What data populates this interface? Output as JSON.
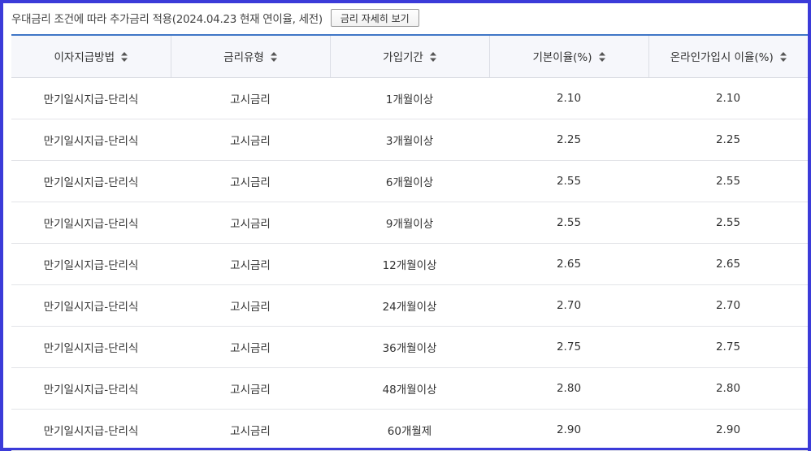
{
  "notice": {
    "text": "우대금리 조건에 따라 추가금리 적용(2024.04.23 현재 연이율, 세전)",
    "detail_button": "금리 자세히 보기"
  },
  "table": {
    "headers": [
      "이자지급방법",
      "금리유형",
      "가입기간",
      "기본이율(%)",
      "온라인가입시 이율(%)"
    ],
    "sort_icon": "sort-up-down-icon",
    "rows": [
      [
        "만기일시지급-단리식",
        "고시금리",
        "1개월이상",
        "2.10",
        "2.10"
      ],
      [
        "만기일시지급-단리식",
        "고시금리",
        "3개월이상",
        "2.25",
        "2.25"
      ],
      [
        "만기일시지급-단리식",
        "고시금리",
        "6개월이상",
        "2.55",
        "2.55"
      ],
      [
        "만기일시지급-단리식",
        "고시금리",
        "9개월이상",
        "2.55",
        "2.55"
      ],
      [
        "만기일시지급-단리식",
        "고시금리",
        "12개월이상",
        "2.65",
        "2.65"
      ],
      [
        "만기일시지급-단리식",
        "고시금리",
        "24개월이상",
        "2.70",
        "2.70"
      ],
      [
        "만기일시지급-단리식",
        "고시금리",
        "36개월이상",
        "2.75",
        "2.75"
      ],
      [
        "만기일시지급-단리식",
        "고시금리",
        "48개월이상",
        "2.80",
        "2.80"
      ],
      [
        "만기일시지급-단리식",
        "고시금리",
        "60개월제",
        "2.90",
        "2.90"
      ]
    ]
  },
  "colors": {
    "frame_border": "#3b3bd9",
    "table_top_border": "#3f76c6",
    "header_background": "#f6f7fb"
  }
}
